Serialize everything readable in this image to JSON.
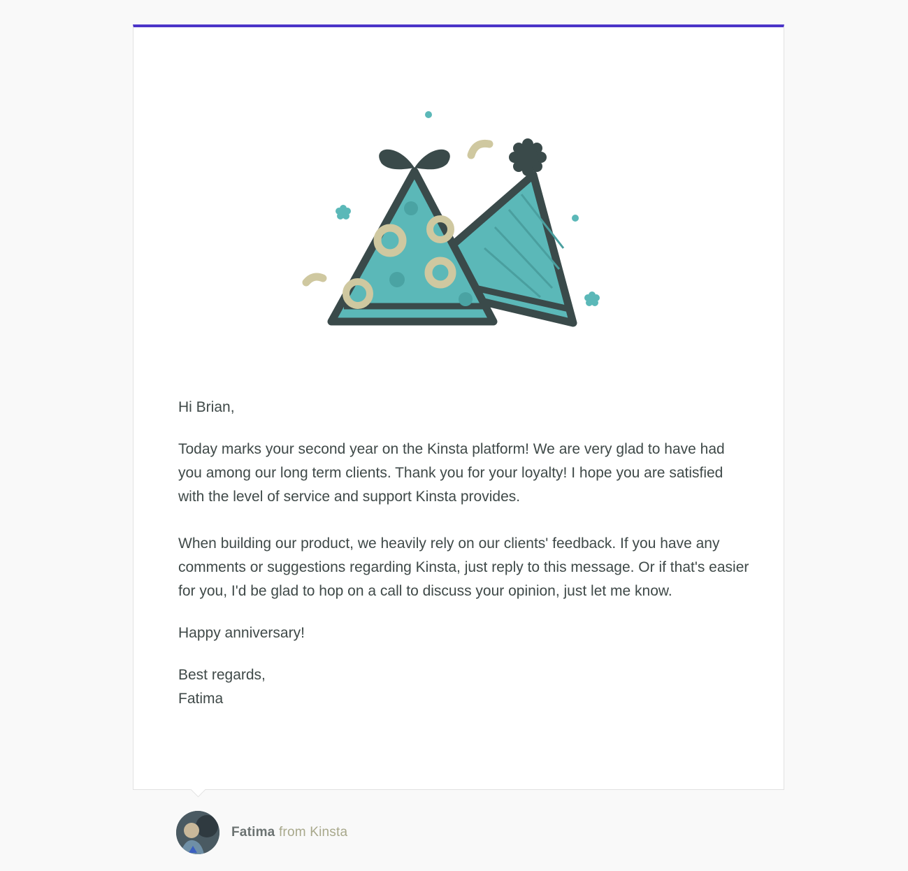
{
  "email": {
    "greeting": "Hi Brian,",
    "paragraphs": [
      "Today marks your second year on the Kinsta platform! We are very glad to have had you among our long term clients. Thank you for your loyalty! I hope you are satisfied with the level of service and support Kinsta provides.",
      "When building our product, we heavily rely on our clients' feedback. If you have any comments or suggestions regarding Kinsta, just reply to this message. Or if that's easier for you, I'd be glad to hop on a call to discuss your opinion, just let me know.",
      "Happy anniversary!"
    ],
    "closing": "Best regards,",
    "signature": "Fatima"
  },
  "sender": {
    "name": "Fatima",
    "org_text": "from Kinsta"
  },
  "hero": {
    "icon": "party-hats-illustration"
  },
  "colors": {
    "accent": "#4b34c8",
    "hat_fill": "#5bb8b8",
    "hat_outline": "#3a4a4a",
    "confetti_teal": "#5bb8b8",
    "confetti_beige": "#cfc8a0",
    "text": "#3f4948"
  }
}
